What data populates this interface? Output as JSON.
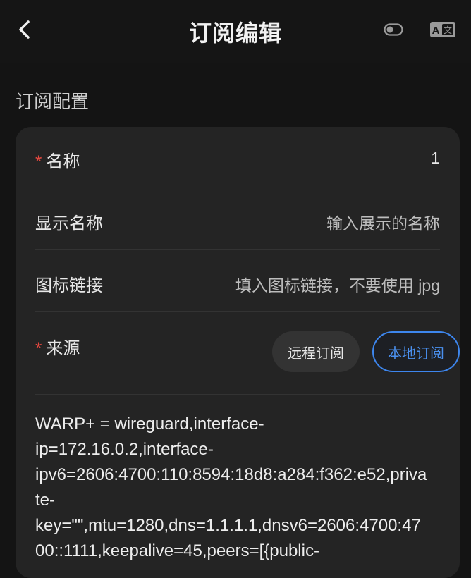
{
  "header": {
    "title": "订阅编辑"
  },
  "section": {
    "title": "订阅配置"
  },
  "form": {
    "name": {
      "label": "名称",
      "value": "1"
    },
    "display_name": {
      "label": "显示名称",
      "placeholder": "输入展示的名称"
    },
    "icon_link": {
      "label": "图标链接",
      "placeholder": "填入图标链接，不要使用 jpg"
    },
    "source": {
      "label": "来源",
      "options": [
        "远程订阅",
        "本地订阅"
      ],
      "selected": "本地订阅"
    },
    "content": "WARP+ = wireguard,interface-\nip=172.16.0.2,interface-\nipv6=2606:4700:110:8594:18d8:a284:f362:e52,priva\nte-\nkey=\"\",mtu=1280,dns=1.1.1.1,dnsv6=2606:4700:47\n00::1111,keepalive=45,peers=[{public-"
  },
  "colors": {
    "required_marker": "#e5483f",
    "accent": "#3d86ee"
  }
}
